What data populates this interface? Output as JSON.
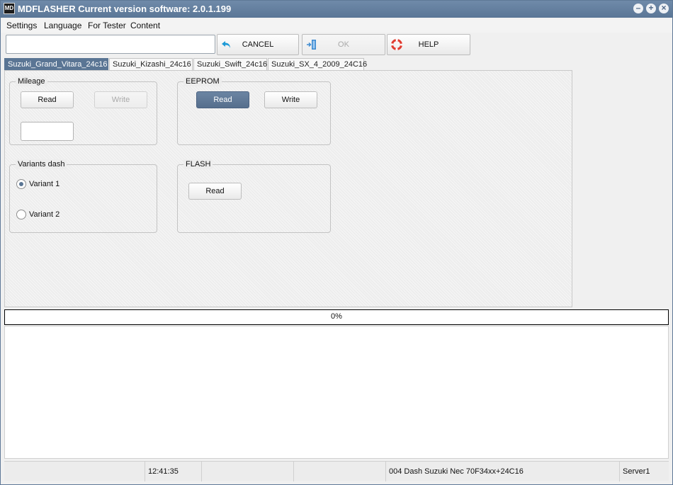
{
  "window": {
    "title": "MDFLASHER  Current version software: 2.0.1.199",
    "icon_text": "MD"
  },
  "menu": [
    "Settings",
    "Language",
    "For Tester",
    "Content"
  ],
  "toolbar": {
    "search_value": "",
    "cancel_label": "CANCEL",
    "ok_label": "OK",
    "help_label": "HELP"
  },
  "tabs": [
    {
      "label": "Suzuki_Grand_Vitara_24c16",
      "active": true
    },
    {
      "label": "Suzuki_Kizashi_24c16",
      "active": false
    },
    {
      "label": "Suzuki_Swift_24c16",
      "active": false
    },
    {
      "label": "Suzuki_SX_4_2009_24C16",
      "active": false
    }
  ],
  "mileage": {
    "title": "Mileage",
    "read_label": "Read",
    "write_label": "Write",
    "value": ""
  },
  "eeprom": {
    "title": "EEPROM",
    "read_label": "Read",
    "write_label": "Write"
  },
  "variants": {
    "title": "Variants dash",
    "options": [
      {
        "label": "Variant 1",
        "checked": true
      },
      {
        "label": "Variant 2",
        "checked": false
      }
    ]
  },
  "flash": {
    "title": "FLASH",
    "read_label": "Read"
  },
  "progress": {
    "percent": 0,
    "label": "0%"
  },
  "status": {
    "time": "12:41:35",
    "device": "004 Dash Suzuki Nec 70F34xx+24C16",
    "server": "Server1"
  },
  "colors": {
    "accent": "#5a7594"
  }
}
